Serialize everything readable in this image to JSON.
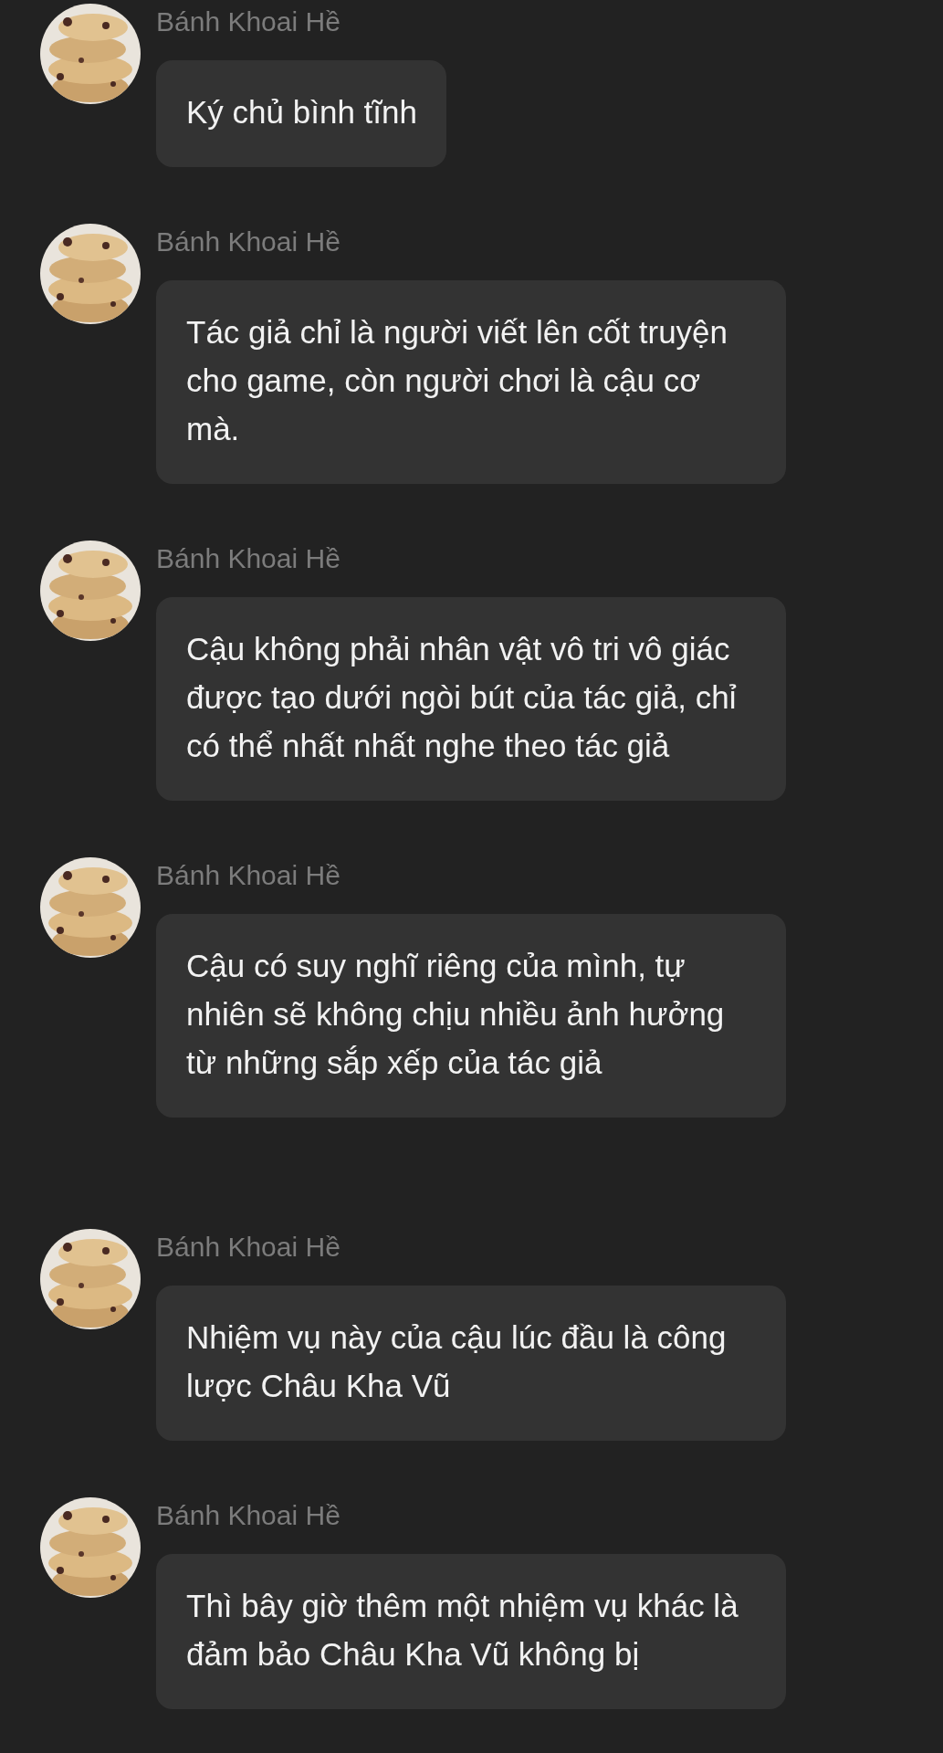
{
  "messages": [
    {
      "sender": "Bánh Khoai Hề",
      "text": "Ký chủ bình tĩnh"
    },
    {
      "sender": "Bánh Khoai Hề",
      "text": "Tác giả chỉ là người viết lên cốt truyện cho game, còn người chơi là cậu cơ mà."
    },
    {
      "sender": "Bánh Khoai Hề",
      "text": "Cậu không phải nhân vật vô tri vô giác được tạo dưới ngòi bút của tác giả, chỉ có thể nhất nhất nghe theo tác giả"
    },
    {
      "sender": "Bánh Khoai Hề",
      "text": "Cậu có suy nghĩ riêng của mình, tự nhiên sẽ không chịu nhiều ảnh hưởng từ những sắp xếp của tác giả"
    },
    {
      "sender": "Bánh Khoai Hề",
      "text": "Nhiệm vụ này của cậu lúc đầu là công lược Châu Kha Vũ"
    },
    {
      "sender": "Bánh Khoai Hề",
      "text": "Thì bây giờ thêm một nhiệm vụ khác là đảm bảo Châu Kha Vũ không bị"
    }
  ]
}
